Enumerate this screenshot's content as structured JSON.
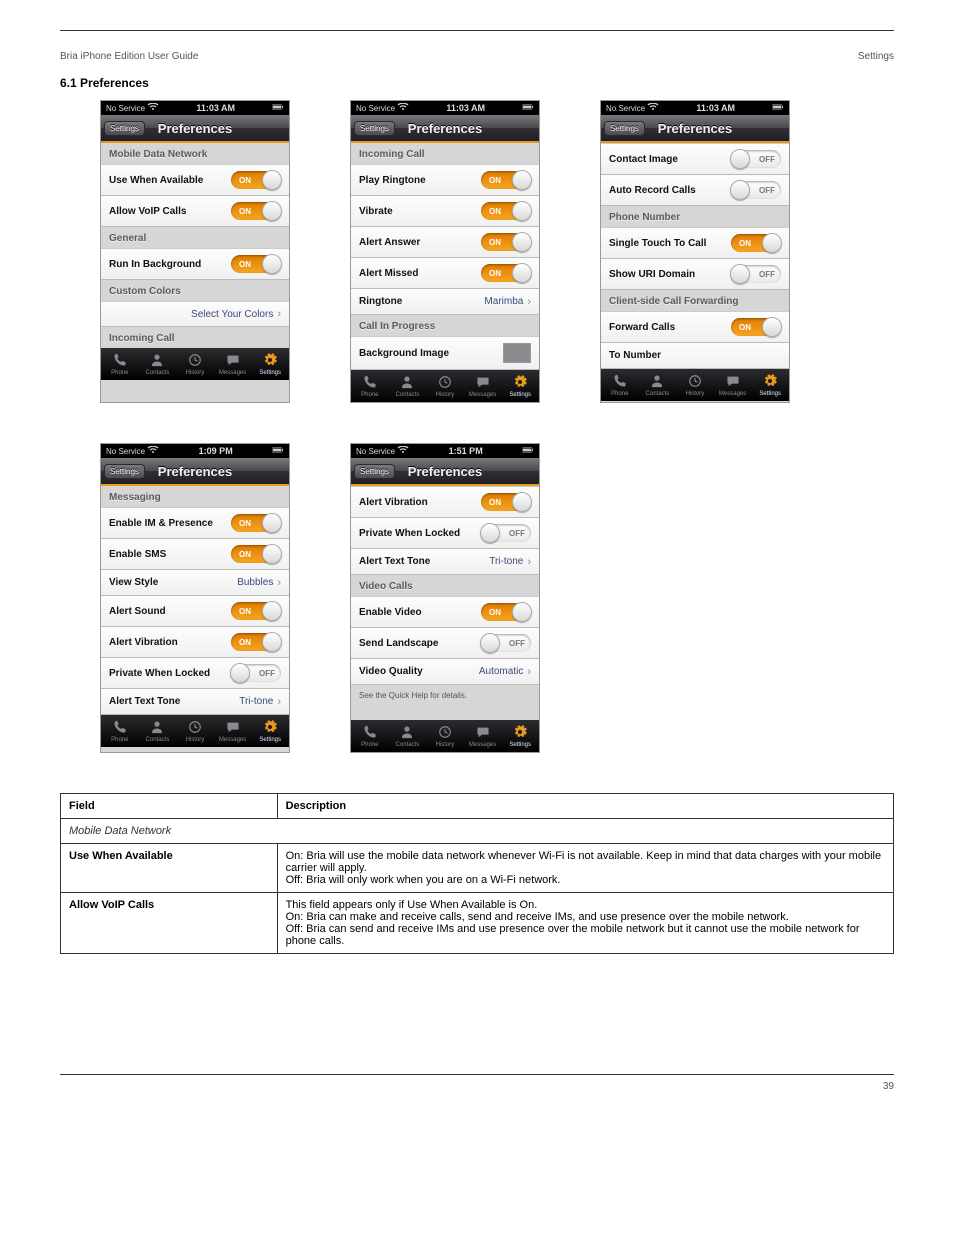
{
  "doc": {
    "header_left": "Bria iPhone Edition User Guide",
    "header_right": "Settings",
    "section_number": "6.1",
    "section_name": "Preferences",
    "footer_left": "",
    "footer_right": "39"
  },
  "common": {
    "statusbar_carrier": "No Service",
    "nav_back": "Settings",
    "nav_title": "Preferences",
    "switch_on": "ON",
    "switch_off": "OFF",
    "tabs": {
      "phone": "Phone",
      "contacts": "Contacts",
      "history": "History",
      "messages": "Messages",
      "settings": "Settings"
    }
  },
  "screens": [
    {
      "time": "11:03 AM",
      "groups": [
        {
          "header": "Mobile Data Network",
          "rows": [
            {
              "label": "Use When Available",
              "control": "switch-on"
            },
            {
              "label": "Allow VoIP Calls",
              "control": "switch-on"
            }
          ]
        },
        {
          "header": "General",
          "rows": [
            {
              "label": "Run In Background",
              "control": "switch-on"
            }
          ]
        },
        {
          "header": "Custom Colors",
          "rows": [
            {
              "label": "",
              "value": "Select Your Colors",
              "disclosure": true,
              "align_right": true
            }
          ]
        },
        {
          "header": "Incoming Call",
          "rows": []
        }
      ]
    },
    {
      "time": "11:03 AM",
      "groups": [
        {
          "header": "Incoming Call",
          "rows": [
            {
              "label": "Play Ringtone",
              "control": "switch-on"
            },
            {
              "label": "Vibrate",
              "control": "switch-on"
            },
            {
              "label": "Alert Answer",
              "control": "switch-on"
            },
            {
              "label": "Alert Missed",
              "control": "switch-on"
            },
            {
              "label": "Ringtone",
              "value": "Marimba",
              "disclosure": true
            }
          ]
        },
        {
          "header": "Call In Progress",
          "rows": [
            {
              "label": "Background Image",
              "thumb": true
            }
          ]
        }
      ]
    },
    {
      "time": "11:03 AM",
      "groups": [
        {
          "header": "",
          "rows": [
            {
              "label": "Contact Image",
              "control": "switch-off"
            },
            {
              "label": "Auto Record Calls",
              "control": "switch-off"
            }
          ]
        },
        {
          "header": "Phone Number",
          "rows": [
            {
              "label": "Single Touch To Call",
              "control": "switch-on"
            },
            {
              "label": "Show URI Domain",
              "control": "switch-off"
            }
          ]
        },
        {
          "header": "Client-side Call Forwarding",
          "rows": [
            {
              "label": "Forward Calls",
              "control": "switch-on"
            },
            {
              "label": "To Number",
              "value": ""
            }
          ]
        }
      ]
    },
    {
      "time": "1:09 PM",
      "groups": [
        {
          "header": "Messaging",
          "rows": [
            {
              "label": "Enable IM & Presence",
              "control": "switch-on"
            },
            {
              "label": "Enable SMS",
              "control": "switch-on"
            },
            {
              "label": "View Style",
              "value": "Bubbles",
              "disclosure": true
            },
            {
              "label": "Alert Sound",
              "control": "switch-on"
            },
            {
              "label": "Alert Vibration",
              "control": "switch-on"
            },
            {
              "label": "Private When Locked",
              "control": "switch-off"
            },
            {
              "label": "Alert Text Tone",
              "value": "Tri-tone",
              "disclosure": true
            }
          ]
        }
      ]
    },
    {
      "time": "1:51 PM",
      "groups": [
        {
          "header": "",
          "rows": [
            {
              "label": "Alert Vibration",
              "control": "switch-on"
            },
            {
              "label": "Private When Locked",
              "control": "switch-off"
            },
            {
              "label": "Alert Text Tone",
              "value": "Tri-tone",
              "disclosure": true
            }
          ]
        },
        {
          "header": "Video Calls",
          "rows": [
            {
              "label": "Enable Video",
              "control": "switch-on"
            },
            {
              "label": "Send Landscape",
              "control": "switch-off"
            },
            {
              "label": "Video Quality",
              "value": "Automatic",
              "disclosure": true
            }
          ]
        }
      ],
      "footer_note": "See the Quick Help for details."
    }
  ],
  "table": {
    "headers": [
      "Field",
      "Description"
    ],
    "section": "Mobile Data Network",
    "rows": [
      {
        "field": "Use When Available",
        "desc": "On: Bria will use the mobile data network whenever Wi-Fi is not available. Keep in mind that data charges with your mobile carrier will apply.\nOff: Bria will only work when you are on a Wi-Fi network."
      },
      {
        "field": "Allow VoIP Calls",
        "desc": "This field appears only if Use When Available is On.\nOn: Bria can make and receive calls, send and receive IMs, and use presence over the mobile network.\nOff: Bria can send and receive IMs and use presence over the mobile network but it cannot use the mobile network for phone calls."
      }
    ]
  }
}
